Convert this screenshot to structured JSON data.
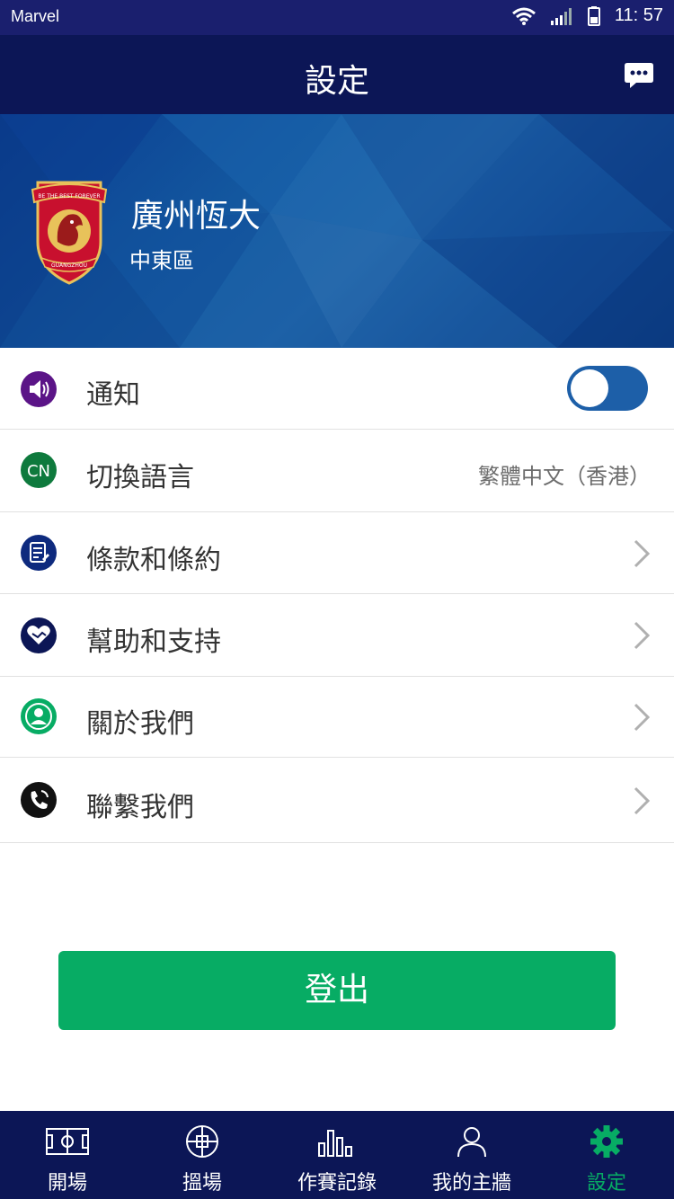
{
  "status_bar": {
    "carrier": "Marvel",
    "time": "11: 57"
  },
  "header": {
    "title": "設定",
    "chat_icon": "chat-bubble-icon"
  },
  "banner": {
    "team_name": "廣州恆大",
    "region": "中東區",
    "crest_text_top": "BE THE BEST FOREVER",
    "crest_text_bottom": "GUANGZHOU"
  },
  "settings": {
    "notify": {
      "label": "通知",
      "icon": "speaker-icon",
      "toggle_on": true
    },
    "language": {
      "label": "切換語言",
      "icon_text": "CN",
      "value": "繁體中文（香港）"
    },
    "terms": {
      "label": "條款和條約",
      "icon": "document-icon"
    },
    "help": {
      "label": "幫助和支持",
      "icon": "heart-handshake-icon"
    },
    "about": {
      "label": "關於我們",
      "icon": "person-icon"
    },
    "contact": {
      "label": "聯繫我們",
      "icon": "phone-icon"
    }
  },
  "logout": {
    "label": "登出"
  },
  "tabbar": {
    "items": [
      {
        "label": "開場",
        "icon": "pitch-icon"
      },
      {
        "label": "搵場",
        "icon": "ball-icon"
      },
      {
        "label": "作賽記錄",
        "icon": "bar-chart-icon"
      },
      {
        "label": "我的主牆",
        "icon": "user-icon"
      },
      {
        "label": "設定",
        "icon": "gear-icon"
      }
    ],
    "active_index": 4
  },
  "colors": {
    "header_bg": "#0c1656",
    "accent_green": "#07ac64",
    "toggle_blue": "#1d5fa8",
    "value_gray": "#6c6c6c"
  }
}
